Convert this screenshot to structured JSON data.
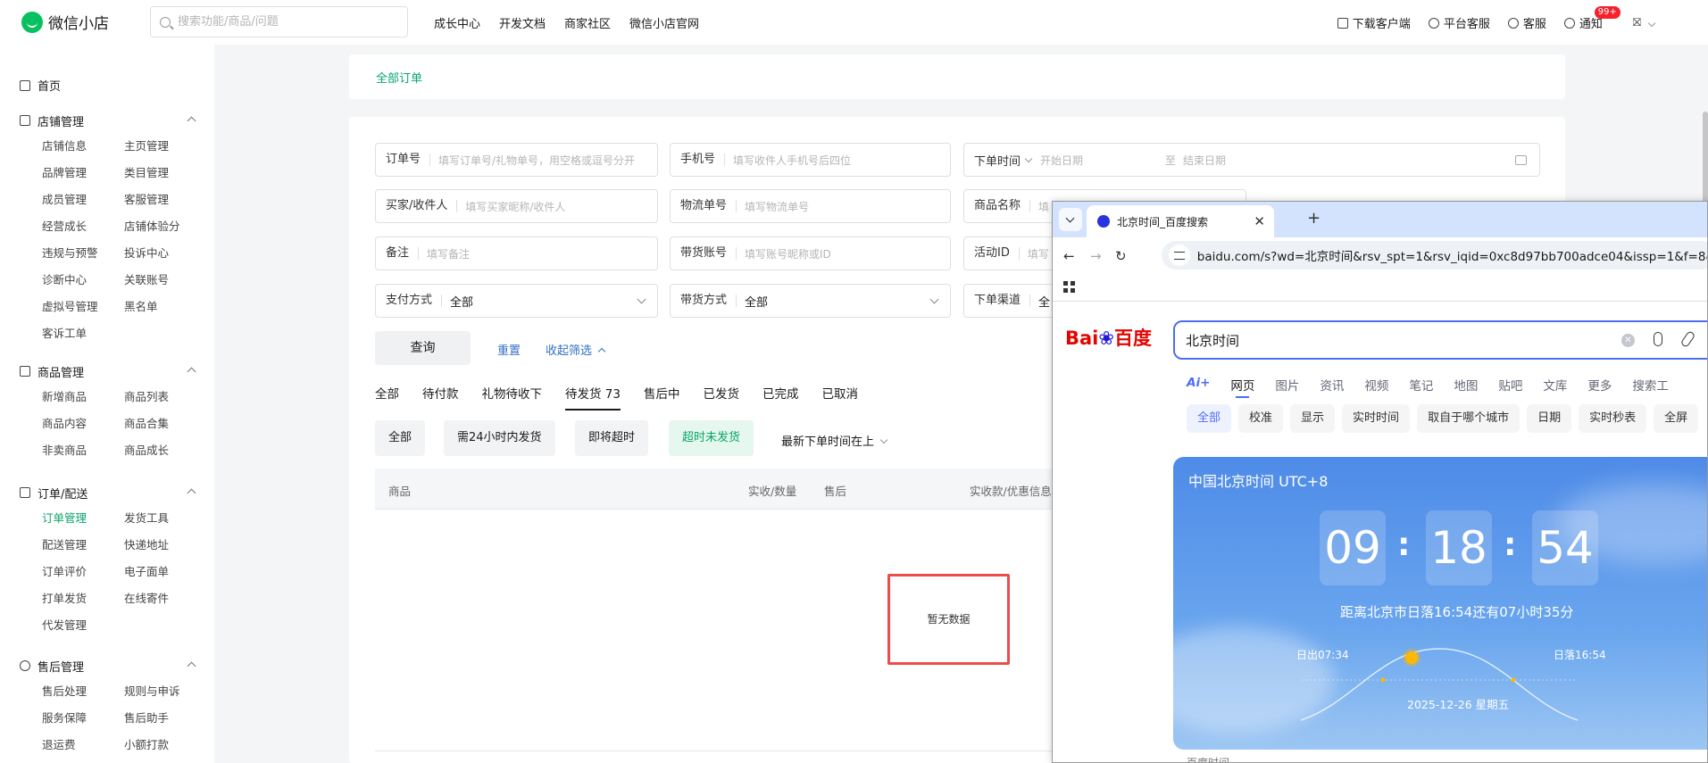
{
  "header": {
    "logo_text": "微信小店",
    "search_placeholder": "搜索功能/商品/问题",
    "nav": [
      "成长中心",
      "开发文档",
      "商家社区",
      "微信小店官网"
    ],
    "download": "下载客户端",
    "platform_service": "平台客服",
    "service": "客服",
    "notify": "通知",
    "notify_badge": "99+",
    "avatar": "⛝"
  },
  "sidebar": {
    "home": "首页",
    "sections": [
      {
        "title": "店铺管理",
        "items": [
          "店铺信息",
          "主页管理",
          "品牌管理",
          "类目管理",
          "成员管理",
          "客服管理",
          "经营成长",
          "店铺体验分",
          "违规与预警",
          "投诉中心",
          "诊断中心",
          "关联账号",
          "虚拟号管理",
          "黑名单",
          "客诉工单"
        ]
      },
      {
        "title": "商品管理",
        "items": [
          "新增商品",
          "商品列表",
          "商品内容",
          "商品合集",
          "非卖商品",
          "商品成长"
        ]
      },
      {
        "title": "订单/配送",
        "items": [
          "订单管理",
          "发货工具",
          "配送管理",
          "快递地址",
          "订单评价",
          "电子面单",
          "打单发货",
          "在线寄件",
          "代发管理"
        ]
      },
      {
        "title": "售后管理",
        "items": [
          "售后处理",
          "规则与申诉",
          "服务保障",
          "售后助手",
          "退运费",
          "小额打款"
        ]
      }
    ]
  },
  "breadcrumb": "全部订单",
  "filters": {
    "order_no": {
      "label": "订单号",
      "placeholder": "填写订单号/礼物单号，用空格或逗号分开"
    },
    "phone": {
      "label": "手机号",
      "placeholder": "填写收件人手机号后四位"
    },
    "order_time": {
      "label": "下单时间",
      "start": "开始日期",
      "to": "至",
      "end": "结束日期"
    },
    "buyer": {
      "label": "买家/收件人",
      "placeholder": "填写买家昵称/收件人"
    },
    "logistics": {
      "label": "物流单号",
      "placeholder": "填写物流单号"
    },
    "product": {
      "label": "商品名称",
      "placeholder": "填"
    },
    "remark": {
      "label": "备注",
      "placeholder": "填写备注"
    },
    "promoter": {
      "label": "带货账号",
      "placeholder": "填写账号昵称或ID"
    },
    "activity": {
      "label": "活动ID",
      "placeholder": "填写"
    },
    "pay_method": {
      "label": "支付方式",
      "value": "全部"
    },
    "promo_method": {
      "label": "带货方式",
      "value": "全部"
    },
    "channel": {
      "label": "下单渠道",
      "value": "全"
    }
  },
  "actions": {
    "query": "查询",
    "reset": "重置",
    "collapse": "收起筛选"
  },
  "tabs": [
    "全部",
    "待付款",
    "礼物待收下",
    "待发货 73",
    "售后中",
    "已发货",
    "已完成",
    "已取消"
  ],
  "chips": [
    "全部",
    "需24小时内发货",
    "即将超时",
    "超时未发货"
  ],
  "sort": "最新下单时间在上",
  "table_headers": [
    "商品",
    "实收/数量",
    "售后",
    "实收款/优惠信息"
  ],
  "empty": "暂无数据",
  "browser": {
    "tab_title": "北京时间_百度搜索",
    "url": "baidu.com/s?wd=北京时间&rsv_spt=1&rsv_iqid=0xc8d97bb700adce04&issp=1&f=8&",
    "logo_a": "Bai",
    "logo_b": "百度",
    "query": "北京时间",
    "nav": [
      "Ai+",
      "网页",
      "图片",
      "资讯",
      "视频",
      "笔记",
      "地图",
      "贴吧",
      "文库",
      "更多",
      "搜索工"
    ],
    "chips": [
      "全部",
      "校准",
      "显示",
      "实时时间",
      "取自于哪个城市",
      "日期",
      "实时秒表",
      "全屏"
    ],
    "clock": {
      "title": "中国北京时间 UTC+8",
      "hh": "09",
      "mm": "18",
      "ss": "54",
      "sunset_info": "距离北京市日落16:54还有07小时35分",
      "sunrise": "日出07:34",
      "sunset": "日落16:54",
      "date": "2025-12-26   星期五"
    },
    "footer": "百度时间"
  }
}
